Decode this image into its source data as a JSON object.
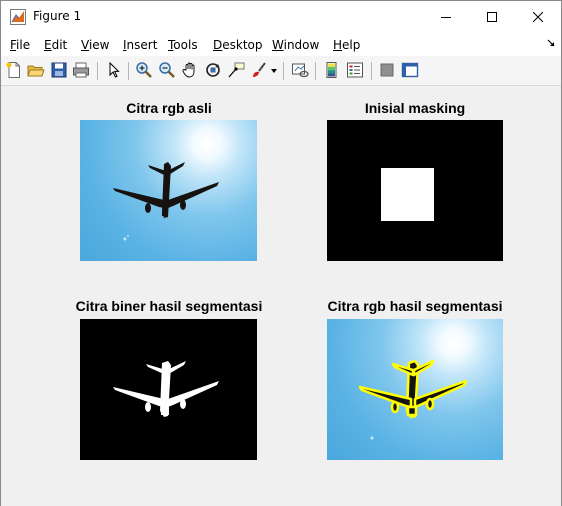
{
  "window": {
    "title": "Figure 1"
  },
  "menu": {
    "items": [
      "File",
      "Edit",
      "View",
      "Insert",
      "Tools",
      "Desktop",
      "Window",
      "Help"
    ],
    "mnemonics": [
      "F",
      "E",
      "V",
      "I",
      "T",
      "D",
      "W",
      "H"
    ]
  },
  "toolbar": {
    "icons": [
      "new-figure-icon",
      "open-file-icon",
      "save-icon",
      "print-icon",
      "pointer-icon",
      "zoom-in-icon",
      "zoom-out-icon",
      "pan-icon",
      "rotate-3d-icon",
      "data-cursor-icon",
      "brush-icon",
      "link-plot-icon",
      "colorbar-icon",
      "legend-icon",
      "hide-plot-tools-icon",
      "show-plot-tools-icon"
    ]
  },
  "subplots": [
    {
      "title": "Citra rgb asli",
      "content": "original-rgb-airplane"
    },
    {
      "title": "Inisial masking",
      "content": "initial-mask"
    },
    {
      "title": "Citra biner hasil segmentasi",
      "content": "binary-segmentation"
    },
    {
      "title": "Citra rgb hasil segmentasi",
      "content": "rgb-segmentation-contour"
    }
  ],
  "colors": {
    "mask_background": "#000000",
    "mask_foreground": "#ffffff",
    "contour": "#ffff00"
  }
}
